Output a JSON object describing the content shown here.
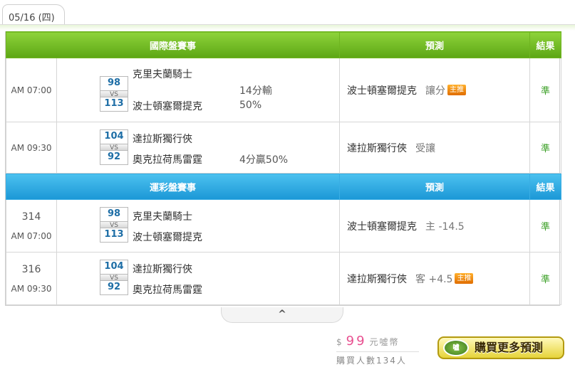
{
  "date_tab": "05/16 (四)",
  "international": {
    "header": {
      "game": "國際盤賽事",
      "prediction": "預測",
      "result": "結果"
    },
    "rows": [
      {
        "time": "AM 07:00",
        "score_a": "98",
        "score_b": "113",
        "vs": "VS",
        "team_a": "克里夫蘭騎士",
        "team_b": "波士頓塞爾提克",
        "handicap_a": "14分輸",
        "handicap_b": "50%",
        "pick": "波士頓塞爾提克",
        "pick_sub": "讓分",
        "badge": "主推",
        "result": "準"
      },
      {
        "time": "AM 09:30",
        "score_a": "104",
        "score_b": "92",
        "vs": "VS",
        "team_a": "達拉斯獨行俠",
        "team_b": "奧克拉荷馬雷霆",
        "handicap_b": "4分贏50%",
        "pick": "達拉斯獨行俠",
        "pick_sub": "受讓",
        "result": "準"
      }
    ]
  },
  "lottery": {
    "header": {
      "game": "運彩盤賽事",
      "prediction": "預測",
      "result": "結果"
    },
    "rows": [
      {
        "num": "314",
        "time": "AM 07:00",
        "score_a": "98",
        "score_b": "113",
        "vs": "VS",
        "team_a": "克里夫蘭騎士",
        "team_b": "波士頓塞爾提克",
        "pick": "波士頓塞爾提克",
        "pick_sub": "主 -14.5",
        "result": "準"
      },
      {
        "num": "316",
        "time": "AM 09:30",
        "score_a": "104",
        "score_b": "92",
        "vs": "VS",
        "team_a": "達拉斯獨行俠",
        "team_b": "奧克拉荷馬雷霆",
        "pick": "達拉斯獨行俠",
        "pick_sub": "客 +4.5",
        "badge": "主推",
        "result": "準"
      }
    ]
  },
  "collapse_icon": "^",
  "footer": {
    "currency": "$",
    "price": "99",
    "unit": "元噓幣",
    "buyers": "購買人數134人",
    "buy_button": "購買更多預測",
    "logo": "噓"
  },
  "colors": {
    "green": "#6bb51c",
    "blue": "#2aa6e2",
    "badge": "#f08a10",
    "result": "#3a9f25"
  }
}
